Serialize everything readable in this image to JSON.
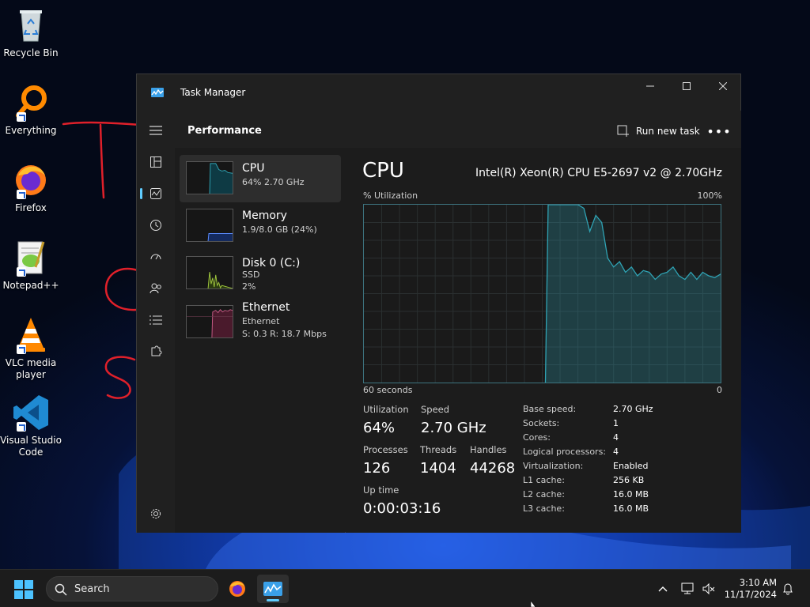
{
  "desktop": {
    "icons": [
      {
        "label": "Recycle Bin",
        "icon": "recycle-bin-icon"
      },
      {
        "label": "Everything",
        "icon": "everything-search-icon"
      },
      {
        "label": "Firefox",
        "icon": "firefox-icon"
      },
      {
        "label": "Notepad++",
        "icon": "notepad-plus-plus-icon"
      },
      {
        "label": "VLC media player",
        "icon": "vlc-icon"
      },
      {
        "label": "Visual Studio Code",
        "icon": "vscode-icon"
      }
    ]
  },
  "window": {
    "title": "Task Manager",
    "page_title": "Performance",
    "run_new_task": "Run new task",
    "more": "•••"
  },
  "perf_list": [
    {
      "name": "CPU",
      "sub1": "64% 2.70 GHz",
      "sub2": "",
      "color": "#2fa3b4"
    },
    {
      "name": "Memory",
      "sub1": "1.9/8.0 GB (24%)",
      "sub2": "",
      "color": "#5b8cff"
    },
    {
      "name": "Disk 0 (C:)",
      "sub1": "SSD",
      "sub2": "2%",
      "color": "#9fc53d"
    },
    {
      "name": "Ethernet",
      "sub1": "Ethernet",
      "sub2": "S: 0.3 R: 18.7 Mbps",
      "color": "#c45a84"
    }
  ],
  "detail": {
    "title": "CPU",
    "cpu_name": "Intel(R) Xeon(R) CPU E5-2697 v2 @ 2.70GHz",
    "y_label": "% Utilization",
    "y_max": "100%",
    "x_left": "60 seconds",
    "x_right": "0",
    "stats": {
      "utilization_label": "Utilization",
      "utilization": "64%",
      "speed_label": "Speed",
      "speed": "2.70 GHz",
      "processes_label": "Processes",
      "processes": "126",
      "threads_label": "Threads",
      "threads": "1404",
      "handles_label": "Handles",
      "handles": "44268",
      "uptime_label": "Up time",
      "uptime": "0:00:03:16"
    },
    "specs": [
      {
        "label": "Base speed:",
        "value": "2.70 GHz"
      },
      {
        "label": "Sockets:",
        "value": "1"
      },
      {
        "label": "Cores:",
        "value": "4"
      },
      {
        "label": "Logical processors:",
        "value": "4"
      },
      {
        "label": "Virtualization:",
        "value": "Enabled"
      },
      {
        "label": "L1 cache:",
        "value": "256 KB"
      },
      {
        "label": "L2 cache:",
        "value": "16.0 MB"
      },
      {
        "label": "L3 cache:",
        "value": "16.0 MB"
      }
    ],
    "cpu_history": [
      0,
      0,
      0,
      0,
      0,
      0,
      0,
      0,
      0,
      0,
      0,
      0,
      0,
      0,
      0,
      0,
      0,
      0,
      0,
      0,
      0,
      0,
      0,
      0,
      0,
      0,
      0,
      0,
      0,
      0,
      0,
      100,
      100,
      100,
      100,
      100,
      100,
      98,
      85,
      94,
      90,
      70,
      65,
      68,
      62,
      65,
      60,
      63,
      62,
      58,
      61,
      62,
      65,
      60,
      58,
      62,
      58,
      62,
      60,
      59,
      61
    ]
  },
  "taskbar": {
    "search_placeholder": "Search",
    "time": "3:10 AM",
    "date": "11/17/2024"
  },
  "colors": {
    "accent": "#60cdff",
    "cpu_graph": "#2fa3b4",
    "annotation": "#e0202a"
  }
}
